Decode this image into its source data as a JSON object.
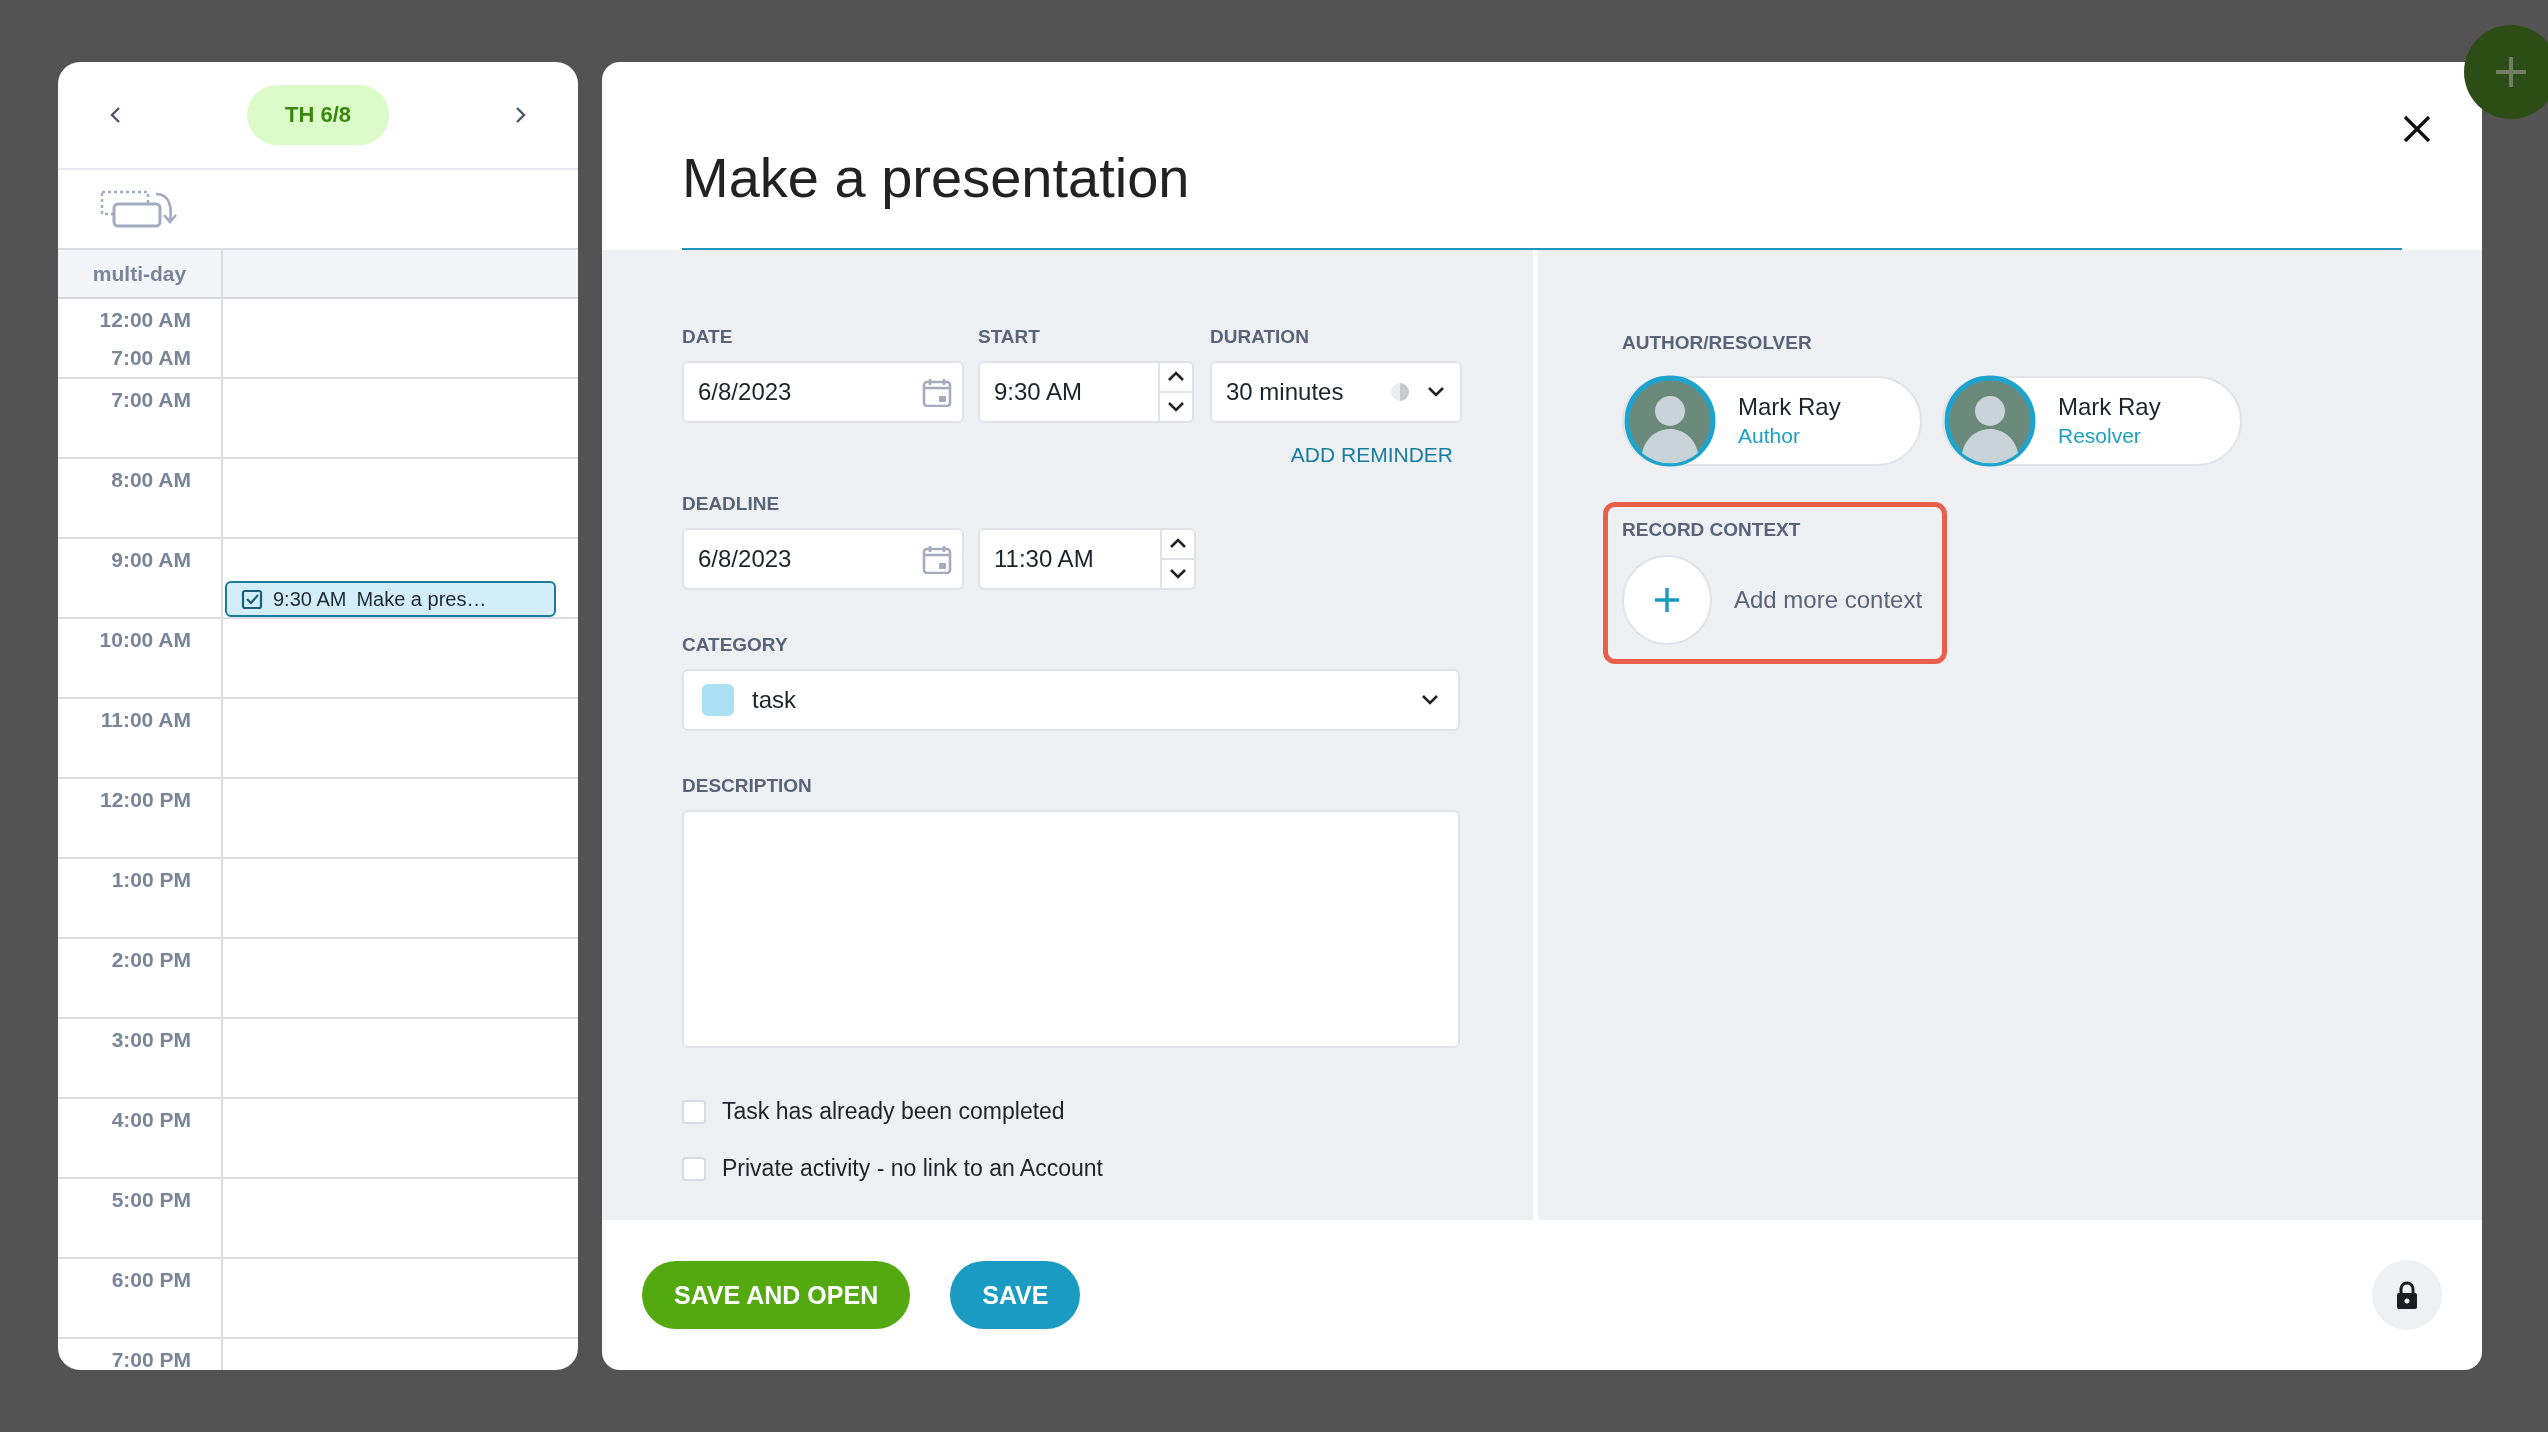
{
  "calendar": {
    "date": "TH 6/8",
    "multi_day_label": "multi-day",
    "hours": [
      {
        "labels": [
          "12:00 AM",
          "7:00 AM"
        ]
      },
      {
        "labels": [
          "7:00 AM"
        ]
      },
      {
        "labels": [
          "8:00 AM"
        ]
      },
      {
        "labels": [
          "9:00 AM"
        ],
        "events": [
          {
            "time": "9:30 AM",
            "title": "Make a pres…",
            "color": "#d3eef9"
          }
        ]
      },
      {
        "labels": [
          "10:00 AM"
        ]
      },
      {
        "labels": [
          "11:00 AM"
        ]
      },
      {
        "labels": [
          "12:00 PM"
        ]
      },
      {
        "labels": [
          "1:00 PM"
        ]
      },
      {
        "labels": [
          "2:00 PM"
        ]
      },
      {
        "labels": [
          "3:00 PM"
        ]
      },
      {
        "labels": [
          "4:00 PM"
        ]
      },
      {
        "labels": [
          "5:00 PM"
        ]
      },
      {
        "labels": [
          "6:00 PM"
        ]
      },
      {
        "labels": [
          "7:00 PM"
        ]
      }
    ]
  },
  "dialog": {
    "title": "Make a presentation",
    "date": {
      "label": "DATE",
      "value": "6/8/2023"
    },
    "start": {
      "label": "START",
      "value": "9:30 AM"
    },
    "duration": {
      "label": "DURATION",
      "value": "30 minutes"
    },
    "add_reminder": "ADD REMINDER",
    "deadline": {
      "label": "DEADLINE",
      "date": "6/8/2023",
      "time": "11:30 AM"
    },
    "category": {
      "label": "CATEGORY",
      "value": "task",
      "color": "#ade0f7"
    },
    "description": {
      "label": "DESCRIPTION"
    },
    "checkboxes": [
      {
        "label": "Task has already been completed",
        "checked": false
      },
      {
        "label": "Private activity - no link to an Account",
        "checked": false
      }
    ],
    "people_label": "AUTHOR/RESOLVER",
    "people": [
      {
        "name": "Mark Ray",
        "role": "Author"
      },
      {
        "name": "Mark Ray",
        "role": "Resolver"
      }
    ],
    "context": {
      "label": "RECORD CONTEXT",
      "action": "Add more context",
      "highlighted": true
    },
    "buttons": [
      {
        "label": "SAVE AND OPEN",
        "kind": "primary"
      },
      {
        "label": "SAVE",
        "kind": "secondary"
      }
    ]
  }
}
